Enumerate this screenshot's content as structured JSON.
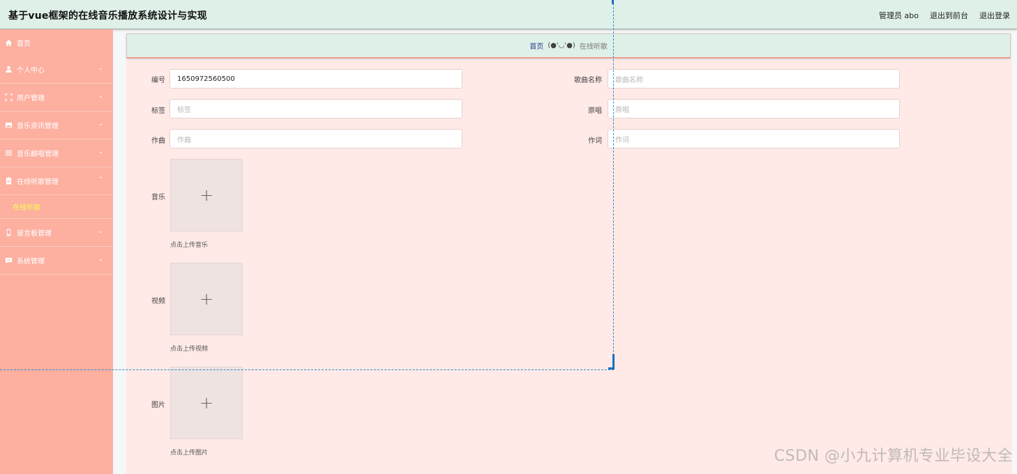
{
  "header": {
    "title": "基于vue框架的在线音乐播放系统设计与实现",
    "user_label": "管理员 abo",
    "exit_front": "退出到前台",
    "logout": "退出登录"
  },
  "sidebar": {
    "items": [
      {
        "label": "首页",
        "icon": "home-icon"
      },
      {
        "label": "个人中心",
        "icon": "user-icon"
      },
      {
        "label": "用户管理",
        "icon": "frame-icon"
      },
      {
        "label": "音乐资讯管理",
        "icon": "image-icon"
      },
      {
        "label": "音乐翻唱管理",
        "icon": "list-icon"
      },
      {
        "label": "在线听歌管理",
        "icon": "clipboard-icon"
      },
      {
        "label": "留言板管理",
        "icon": "phone-icon"
      },
      {
        "label": "系统管理",
        "icon": "chat-icon"
      }
    ],
    "submenu_active": "在线听歌"
  },
  "breadcrumb": {
    "home": "首页",
    "separator": "(●'◡'●)",
    "current": "在线听歌"
  },
  "form": {
    "number_label": "编号",
    "number_value": "1650972560500",
    "song_name_label": "歌曲名称",
    "song_name_placeholder": "歌曲名称",
    "tag_label": "标签",
    "tag_placeholder": "标签",
    "singer_label": "原唱",
    "singer_placeholder": "原唱",
    "composer_label": "作曲",
    "composer_placeholder": "作曲",
    "lyricist_label": "作词",
    "lyricist_placeholder": "作词",
    "music_label": "音乐",
    "music_hint": "点击上传音乐",
    "video_label": "视频",
    "video_hint": "点击上传视频",
    "image_label": "图片",
    "image_hint": "点击上传图片",
    "plus_symbol": "+"
  },
  "watermark": "CSDN @小九计算机专业毕设大全",
  "colors": {
    "header_bg": "#dff0e8",
    "sidebar_bg": "#fdafa0",
    "panel_bg": "#ffeae7",
    "active_submenu": "#f7ff57"
  }
}
